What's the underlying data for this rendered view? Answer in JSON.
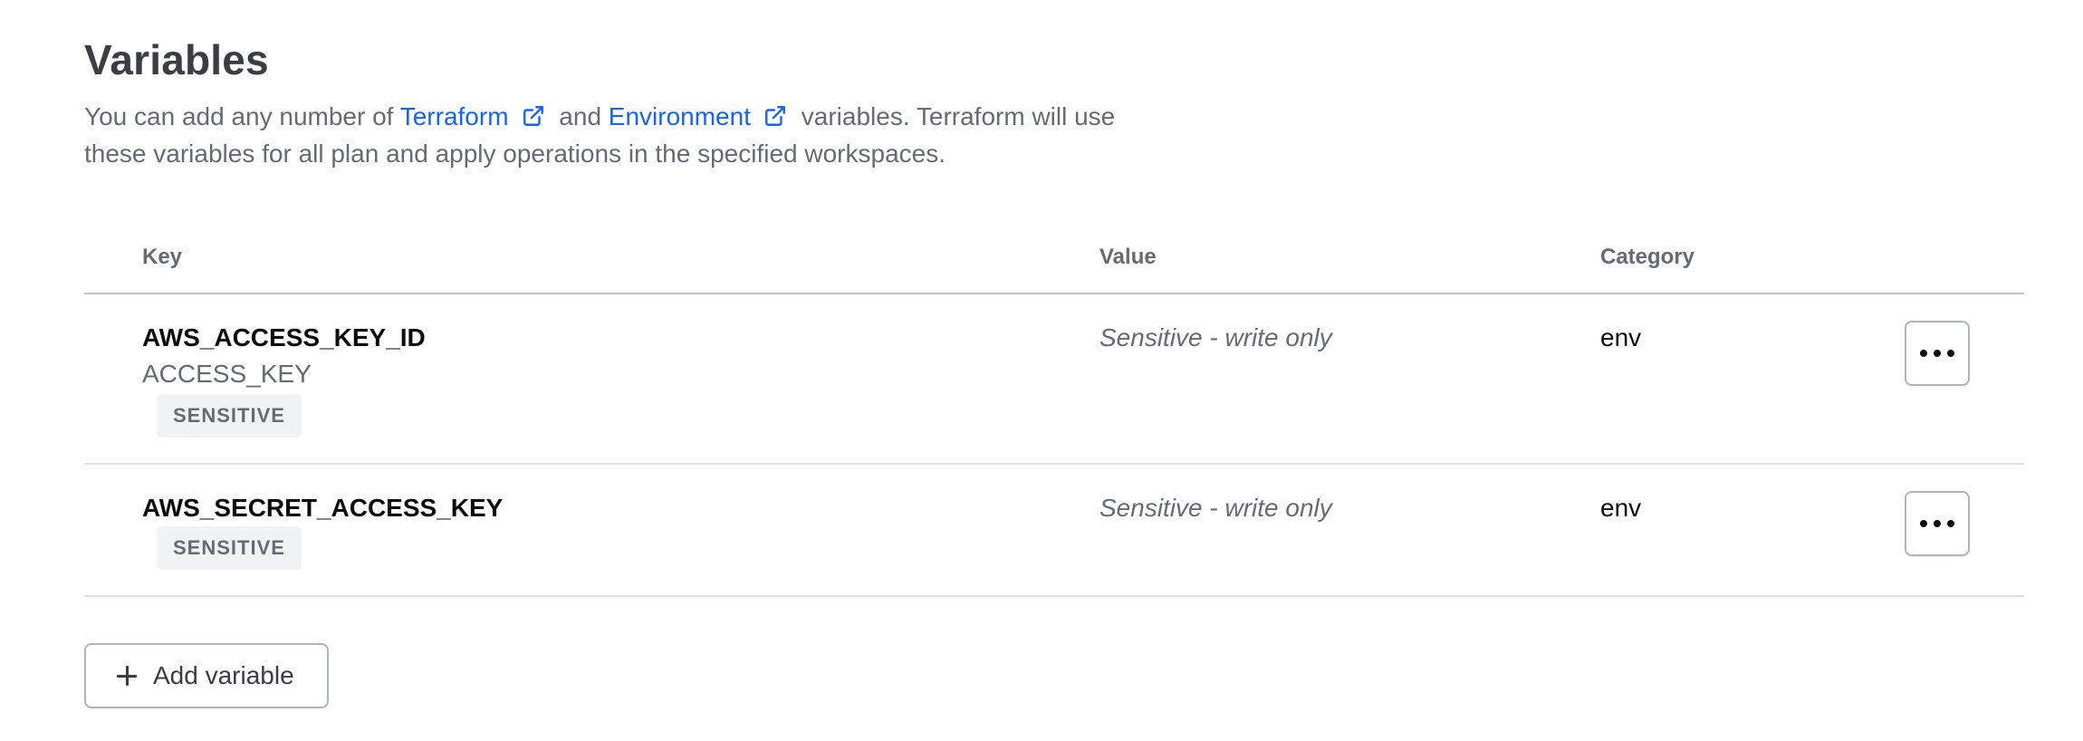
{
  "page": {
    "title": "Variables",
    "intro": {
      "text_before": "You can add any number of ",
      "link_terraform": "Terraform",
      "text_and": " and ",
      "link_environment": "Environment",
      "text_after": " variables. Terraform will use these variables for all plan and apply operations in the specified workspaces."
    }
  },
  "table": {
    "headers": {
      "key": "Key",
      "value": "Value",
      "category": "Category"
    },
    "rows": [
      {
        "key": "AWS_ACCESS_KEY_ID",
        "description": "ACCESS_KEY",
        "badge": "SENSITIVE",
        "value": "Sensitive - write only",
        "category": "env",
        "menu_icon": "ellipsis-icon"
      },
      {
        "key": "AWS_SECRET_ACCESS_KEY",
        "badge": "SENSITIVE",
        "value": "Sensitive - write only",
        "category": "env",
        "menu_icon": "ellipsis-icon"
      }
    ]
  },
  "actions": {
    "add_variable_label": "Add variable",
    "add_icon": "plus-icon"
  },
  "colors": {
    "link": "#1563ff",
    "text": "#3b3d45",
    "muted": "#656a76",
    "border": "#c2c5cb",
    "badge_bg": "#f1f2f3"
  }
}
